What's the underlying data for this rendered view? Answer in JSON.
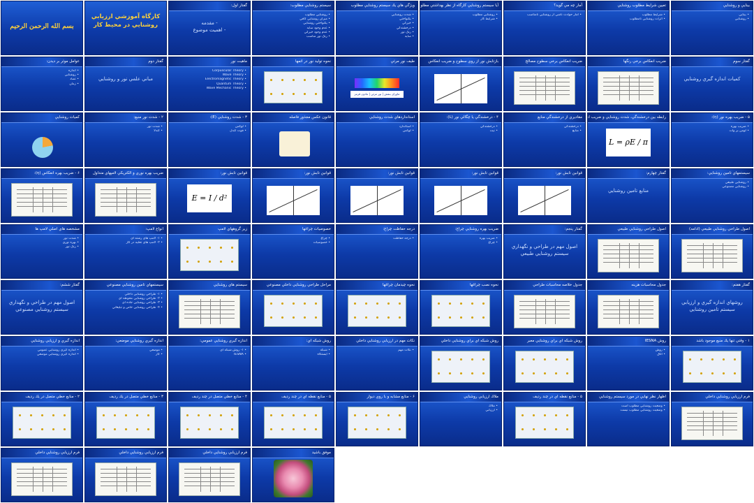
{
  "slides": [
    {
      "type": "title",
      "header": "",
      "center": "بسم الله الرحمن الرحيم"
    },
    {
      "type": "title",
      "header": "",
      "center": "كارگاه آموزشي ارزيابي روشنايي در محيط كار"
    },
    {
      "type": "text",
      "header": "گفتار اول:",
      "center": "- مقدمه\n- اهميت موضوع"
    },
    {
      "type": "text",
      "header": "سيستم روشنايي مطلوب:",
      "lines": [
        "روشنايي مطلوب",
        "ميزان روشنايي كافي",
        "يكنواختي روشنايي",
        "عدم وجود سايه",
        "عدم وجود خيرگي",
        "رنگ نور مناسب"
      ]
    },
    {
      "type": "text",
      "header": "ويژگي هاي يك سيستم روشنايي مطلوب",
      "lines": [
        "شدت روشنايي",
        "يكنواختي",
        "خيرگي",
        "درخشندگي",
        "رنگ نور",
        "سايه"
      ]
    },
    {
      "type": "text",
      "header": "آيا سيستم روشنايي كارگاه از نظر بهداشتي مطلوب است؟",
      "lines": [
        "روشنايي مطلوب",
        "شرايط كار"
      ]
    },
    {
      "type": "text",
      "header": "آمار چه مي گويد؟",
      "lines": [
        "آمار حوادث ناشي از روشنايي نامناسب"
      ]
    },
    {
      "type": "text",
      "header": "تعيين شرايط مطلوب روشنايي",
      "lines": [
        "شرايط مطلوب",
        "اثرات روشنايي نامطلوب"
      ]
    },
    {
      "type": "text",
      "header": "بينايي و روشنايي",
      "lines": [
        "بينايي",
        "روشنايي"
      ]
    },
    {
      "type": "text",
      "header": "عوامل موثر بر ديدن:",
      "lines": [
        "اندازه",
        "روشنايي",
        "تضاد",
        "زمان"
      ]
    },
    {
      "type": "text",
      "header": "گفتار دوم",
      "center": "مباني علمي نور و روشنايي"
    },
    {
      "type": "text",
      "header": "ماهيت نور",
      "lines": [
        "Corpuscular Theory",
        "Wave Theory",
        "Electromagnetic Theory",
        "Quantum Theory",
        "Wave Mechanic Theory"
      ]
    },
    {
      "type": "diagram",
      "header": "نحوه توليد نور در اتمها"
    },
    {
      "type": "spectrum",
      "header": "طيف نور مرئي",
      "formula": "ماورای بنفش | نور مرئي | مادون قرمز"
    },
    {
      "type": "rays",
      "header": "بازتابش نور از روي سطوح و ضريب انعكاس"
    },
    {
      "type": "table",
      "header": "ضريب انعكاس برخي سطوح مصالح"
    },
    {
      "type": "table",
      "header": "ضريب انعكاس برخي رنگها"
    },
    {
      "type": "text",
      "header": "گفتار سوم",
      "center": "كميات اندازه گيري روشنايي"
    },
    {
      "type": "pie",
      "header": "كميات روشنايي"
    },
    {
      "type": "text",
      "header": "۲ - شدت نور منبع:",
      "lines": [
        "شدت نور",
        "كندلا"
      ]
    },
    {
      "type": "text",
      "header": "۳ - شدت روشنايي (E):",
      "lines": [
        "لوكس",
        "فوت كندل"
      ]
    },
    {
      "type": "bulb",
      "header": "قانون عكس مجذور فاصله"
    },
    {
      "type": "text",
      "header": "استانداردهاي شدت روشنايي",
      "lines": [
        "استاندارد",
        "لوكس"
      ]
    },
    {
      "type": "text",
      "header": "۴ - درخشندگي يا چگالي نور (L):",
      "lines": [
        "درخشندگي",
        "نيت"
      ]
    },
    {
      "type": "text",
      "header": "مقاديري از درخشندگي منابع",
      "lines": [
        "درخشندگي",
        "منابع"
      ]
    },
    {
      "type": "text",
      "header": "رابطه بين درخشندگي، شدت روشنايي و ضريب انعكاس سطوح",
      "formula": "L = ρE / π"
    },
    {
      "type": "text",
      "header": "۵ - ضريب بهره نور (η):",
      "lines": [
        "ضريب بهره",
        "لومن بر وات"
      ]
    },
    {
      "type": "table",
      "header": "۶ - ضريب بهره انعكاس (η):"
    },
    {
      "type": "table",
      "header": "ضريب بهره نوري و الكتريكي لامپهاي متداول"
    },
    {
      "type": "formula",
      "header": "قوانين تابش نور:",
      "formula": "E = I / d²"
    },
    {
      "type": "rays",
      "header": "قوانين تابش نور:"
    },
    {
      "type": "rays",
      "header": "قوانين تابش نور:"
    },
    {
      "type": "rays",
      "header": "قوانين تابش نور:"
    },
    {
      "type": "rays",
      "header": "قوانين تابش نور:"
    },
    {
      "type": "text",
      "header": "گفتار چهارم:",
      "center": "منابع تامين روشنايي"
    },
    {
      "type": "text",
      "header": "سيستمهاي تامين روشنايي:",
      "lines": [
        "روشنايي طبيعي",
        "روشنايي مصنوعي"
      ]
    },
    {
      "type": "text",
      "header": "مشخصه هاي اصلي لامپ ها",
      "lines": [
        "شدت نور",
        "بهره نوري",
        "رنگ نور"
      ]
    },
    {
      "type": "text",
      "header": "انواع لامپ:",
      "lines": [
        "۱- لامپ هاي رشته اي",
        "۲- لامپ هاي تخليه در گاز"
      ]
    },
    {
      "type": "diagram",
      "header": "زير گروههاي لامپ"
    },
    {
      "type": "text",
      "header": "خصوصيات چراغها",
      "lines": [
        "چراغ",
        "خصوصيات"
      ]
    },
    {
      "type": "text",
      "header": "درجه حفاظت چراغ:",
      "lines": [
        "درجه حفاظت"
      ]
    },
    {
      "type": "text",
      "header": "ضريب بهره روشنايي چراغ:",
      "lines": [
        "ضريب بهره",
        "چراغ"
      ]
    },
    {
      "type": "text",
      "header": "گفتار پنجم:",
      "center": "اصول مهم در طراحي و نگهداري سيستم روشنايي طبيعي"
    },
    {
      "type": "table",
      "header": "اصول طراحي روشنايي طبيعي"
    },
    {
      "type": "table",
      "header": "اصول طراحي روشنايي طبيعي (ادامه)"
    },
    {
      "type": "text",
      "header": "گفتار ششم:",
      "center": "اصول مهم در طراحي و نگهداري سيستم روشنايي مصنوعي"
    },
    {
      "type": "text",
      "header": "سيستمهاي تامين روشنايي مصنوعي",
      "lines": [
        "۱- طراحي روشنايي داخلي",
        "۲- طراحي روشنايي محوطه اي",
        "۳- طراحي روشنايي جاده اي",
        "۴- طراحي روشنايي خاص و تبليغاتي"
      ]
    },
    {
      "type": "table",
      "header": "سيستم هاي روشنايي"
    },
    {
      "type": "diagram",
      "header": "مراحل طراحي روشنايي داخلي مصنوعي"
    },
    {
      "type": "diagram",
      "header": "نحوه چيدمان چراغها"
    },
    {
      "type": "diagram",
      "header": "نحوه نصب چراغها"
    },
    {
      "type": "table",
      "header": "جدول خلاصه محاسبات طراحي"
    },
    {
      "type": "table",
      "header": "جدول محاسبات هزينه"
    },
    {
      "type": "text",
      "header": "گفتار هفتم:",
      "center": "روشهاي اندازه گيري و ارزيابي سيستم تامين روشنايي"
    },
    {
      "type": "text",
      "header": "اندازه گيري و ارزيابي روشنايي",
      "lines": [
        "اندازه گيري روشنايي عمومي",
        "اندازه گيري روشنايي موضعي"
      ]
    },
    {
      "type": "text",
      "header": "اندازه گيري روشنايي موضعي:",
      "lines": [
        "موضعي",
        "كار"
      ]
    },
    {
      "type": "text",
      "header": "اندازه گيري روشنايي عمومي:",
      "lines": [
        "۱- روش شبكه اي",
        "IESNA"
      ]
    },
    {
      "type": "text",
      "header": "روش شبكه اي:",
      "lines": [
        "شبكه",
        "ايستگاه"
      ]
    },
    {
      "type": "text",
      "header": "نكات مهم در ارزيابي روشنايي داخلي",
      "lines": [
        "نكات مهم"
      ]
    },
    {
      "type": "diagram",
      "header": "روش شبكه اي براي روشنايي داخلي"
    },
    {
      "type": "diagram",
      "header": "روش شبكه اي براي روشنايي معبر"
    },
    {
      "type": "text",
      "header": "روش IESNA",
      "lines": [
        "روش",
        "اتاق"
      ]
    },
    {
      "type": "diagram",
      "header": "۱ - وقتي تنها يك منبع موجود باشد"
    },
    {
      "type": "diagram",
      "header": "۲ - منابع خطي متصل در يك رديف"
    },
    {
      "type": "diagram",
      "header": "۳ - منابع خطي متصل در يك رديف"
    },
    {
      "type": "diagram",
      "header": "۴ - منابع خطي متصل در چند رديف"
    },
    {
      "type": "diagram",
      "header": "۵ - منابع نقطه اي در چند رديف"
    },
    {
      "type": "diagram",
      "header": "۶ - منابع مشابه و با روي ديوار"
    },
    {
      "type": "text",
      "header": "ملاك ارزيابي روشنايي",
      "lines": [
        "ملاك",
        "ارزيابي"
      ]
    },
    {
      "type": "diagram",
      "header": "۵ - منابع نقطه اي در چند رديف"
    },
    {
      "type": "text",
      "header": "اظهار نظر نهايي در مورد سيستم روشنايي",
      "lines": [
        "وضعيت روشنايي مطلوب است",
        "وضعيت روشنايي مطلوب نيست"
      ]
    },
    {
      "type": "table",
      "header": "فرم ارزيابي روشنايي داخلي"
    },
    {
      "type": "table",
      "header": "فرم ارزيابي روشنايي داخلي"
    },
    {
      "type": "table",
      "header": "فرم ارزيابي روشنايي داخلي"
    },
    {
      "type": "table",
      "header": "فرم ارزيابي روشنايي داخلي"
    },
    {
      "type": "rose",
      "header": "موفق باشيد"
    }
  ]
}
